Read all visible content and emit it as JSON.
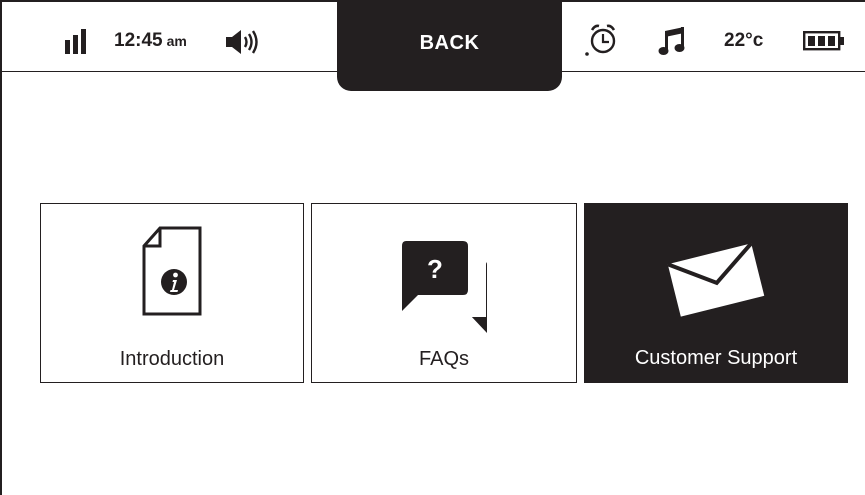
{
  "status_bar": {
    "time": "12:45",
    "time_suffix": "am",
    "temperature": "22°c",
    "icons": [
      "signal-icon",
      "speaker-icon",
      "alarm-icon",
      "music-note-icon",
      "battery-icon"
    ]
  },
  "back_button": {
    "label": "BACK"
  },
  "tiles": [
    {
      "label": "Introduction",
      "icon": "info-document-icon",
      "selected": false
    },
    {
      "label": "FAQs",
      "icon": "faq-chat-icon",
      "selected": false
    },
    {
      "label": "Customer Support",
      "icon": "envelope-icon",
      "selected": true
    }
  ],
  "colors": {
    "foreground": "#231f20",
    "background": "#ffffff"
  }
}
